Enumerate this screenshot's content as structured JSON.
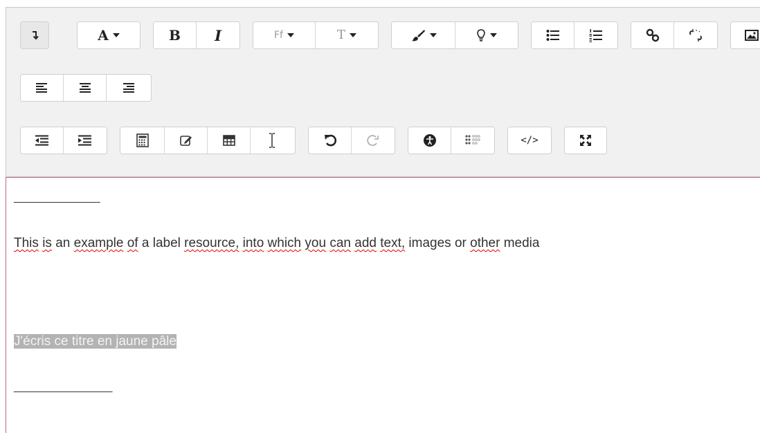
{
  "toolbar": {
    "font_glyph": "A",
    "bold_glyph": "B",
    "italic_glyph": "I",
    "font_family_glyph": "Ff",
    "font_size_glyph": "T",
    "html_glyph": "</>"
  },
  "content": {
    "separator_top": "______________",
    "line1_words": [
      "This",
      " ",
      "is",
      " an ",
      "example",
      " ",
      "of",
      " a label ",
      "resource,",
      " ",
      "into",
      " ",
      "which",
      " ",
      "you",
      " ",
      "can",
      " ",
      "add",
      " ",
      "text,",
      " images or ",
      "other",
      " media"
    ],
    "title_text": "J'écris ce titre en jaune pâle",
    "separator_bottom": "________________"
  },
  "colors": {
    "toolbar_bg": "#f1f1f1",
    "content_border": "#b76d85",
    "highlight_bg": "#b3b3b3",
    "spellcheck_underline": "#e00000"
  }
}
